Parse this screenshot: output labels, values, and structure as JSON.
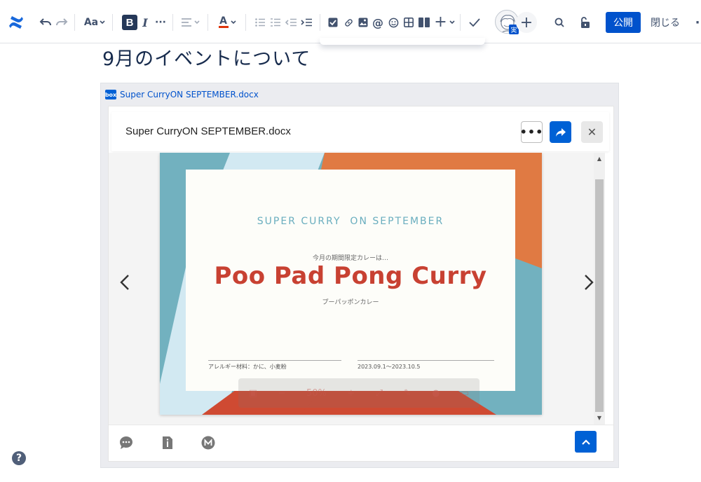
{
  "toolbar": {
    "text_style_label": "Aa",
    "bold_label": "B",
    "italic_label": "I",
    "more_label": "···",
    "text_color_label": "A",
    "text_color_accent": "#de350b",
    "avatar_badge": "実",
    "publish_label": "公開",
    "close_label": "閉じる",
    "overflow_label": "·"
  },
  "page": {
    "title": "9月のイベントについて"
  },
  "embed": {
    "source_label": "Super CurryON SEPTEMBER.docx",
    "box_logo_text": "box",
    "viewer": {
      "title": "Super CurryON SEPTEMBER.docx",
      "more_label": "•••",
      "close_label": "✕"
    },
    "document": {
      "heading": "SUPER CURRY  ON SEPTEMBER",
      "subheading": "今月の期間限定カレーは…",
      "main_title": "Poo Pad Pong Curry",
      "reading": "プーパッポンカレー",
      "allergy": "アレルギー材料：かに、小麦粉",
      "period": "2023.09.1～2023.10.5",
      "zoom_level": "50%"
    }
  },
  "help_label": "?"
}
